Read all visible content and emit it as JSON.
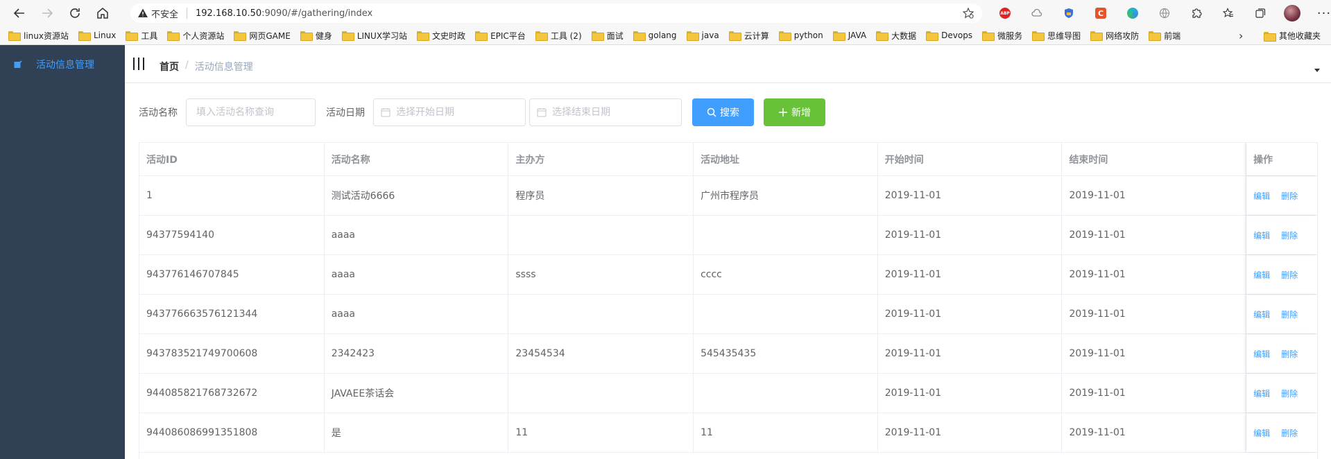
{
  "browser": {
    "security_label": "不安全",
    "url_host": "192.168.10.50",
    "url_rest": ":9090/#/gathering/index"
  },
  "bookmarks": {
    "items": [
      {
        "label": "linux资源站"
      },
      {
        "label": "Linux"
      },
      {
        "label": "工具"
      },
      {
        "label": "个人资源站"
      },
      {
        "label": "网页GAME"
      },
      {
        "label": "健身"
      },
      {
        "label": "LINUX学习站"
      },
      {
        "label": "文史时政"
      },
      {
        "label": "EPIC平台"
      },
      {
        "label": "工具 (2)"
      },
      {
        "label": "面试"
      },
      {
        "label": "golang"
      },
      {
        "label": "java"
      },
      {
        "label": "云计算"
      },
      {
        "label": "python"
      },
      {
        "label": "JAVA"
      },
      {
        "label": "大数据"
      },
      {
        "label": "Devops"
      },
      {
        "label": "微服务"
      },
      {
        "label": "思维导图"
      },
      {
        "label": "网络攻防"
      },
      {
        "label": "前端"
      }
    ],
    "other": "其他收藏夹"
  },
  "sidebar": {
    "items": [
      {
        "label": "活动信息管理"
      }
    ]
  },
  "breadcrumb": {
    "home": "首页",
    "separator": "/",
    "current": "活动信息管理"
  },
  "filter": {
    "name_label": "活动名称",
    "name_placeholder": "填入活动名称查询",
    "date_label": "活动日期",
    "start_placeholder": "选择开始日期",
    "end_placeholder": "选择结束日期",
    "search_button": "搜索",
    "add_button": "新增"
  },
  "table": {
    "columns": [
      "活动ID",
      "活动名称",
      "主办方",
      "活动地址",
      "开始时间",
      "结束时间",
      "操作"
    ],
    "edit_label": "编辑",
    "delete_label": "删除",
    "rows": [
      {
        "id": "1",
        "name": "测试活动6666",
        "sponsor": "程序员",
        "address": "广州市程序员",
        "start": "2019-11-01",
        "end": "2019-11-01"
      },
      {
        "id": "94377594140",
        "name": "aaaa",
        "sponsor": "",
        "address": "",
        "start": "2019-11-01",
        "end": "2019-11-01"
      },
      {
        "id": "943776146707845",
        "name": "aaaa",
        "sponsor": "ssss",
        "address": "cccc",
        "start": "2019-11-01",
        "end": "2019-11-01"
      },
      {
        "id": "943776663576121344",
        "name": "aaaa",
        "sponsor": "",
        "address": "",
        "start": "2019-11-01",
        "end": "2019-11-01"
      },
      {
        "id": "943783521749700608",
        "name": "2342423",
        "sponsor": "23454534",
        "address": "545435435",
        "start": "2019-11-01",
        "end": "2019-11-01"
      },
      {
        "id": "944085821768732672",
        "name": "JAVAEE茶话会",
        "sponsor": "",
        "address": "",
        "start": "2019-11-01",
        "end": "2019-11-01"
      },
      {
        "id": "944086086991351808",
        "name": "是",
        "sponsor": "11",
        "address": "11",
        "start": "2019-11-01",
        "end": "2019-11-01"
      }
    ]
  },
  "colors": {
    "sidebar_bg": "#304156",
    "primary": "#409eff",
    "success": "#67c23a"
  }
}
